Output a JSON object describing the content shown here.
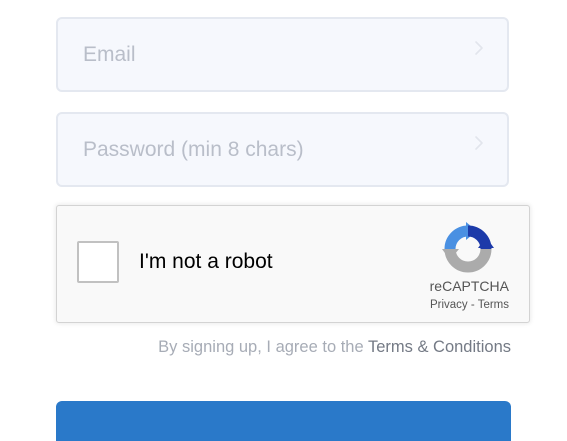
{
  "form": {
    "email": {
      "placeholder": "Email",
      "value": ""
    },
    "password": {
      "placeholder": "Password (min 8 chars)",
      "value": ""
    }
  },
  "recaptcha": {
    "label": "I'm not a robot",
    "brand": "reCAPTCHA",
    "privacy_link": "Privacy",
    "separator": " - ",
    "terms_link": "Terms"
  },
  "agreement": {
    "prefix": "By signing up, I agree to the ",
    "link": "Terms & Conditions"
  },
  "colors": {
    "field_background": "#f6f8fd",
    "field_border": "#e4e8f0",
    "submit_button": "#2a79c9",
    "recaptcha_blue": "#4a90e2",
    "recaptcha_dark_blue": "#1c3aa9",
    "recaptcha_gray": "#ababab"
  },
  "icons": {
    "field_chevron": "chevron-right-icon",
    "recaptcha_logo": "recaptcha-logo-icon"
  }
}
